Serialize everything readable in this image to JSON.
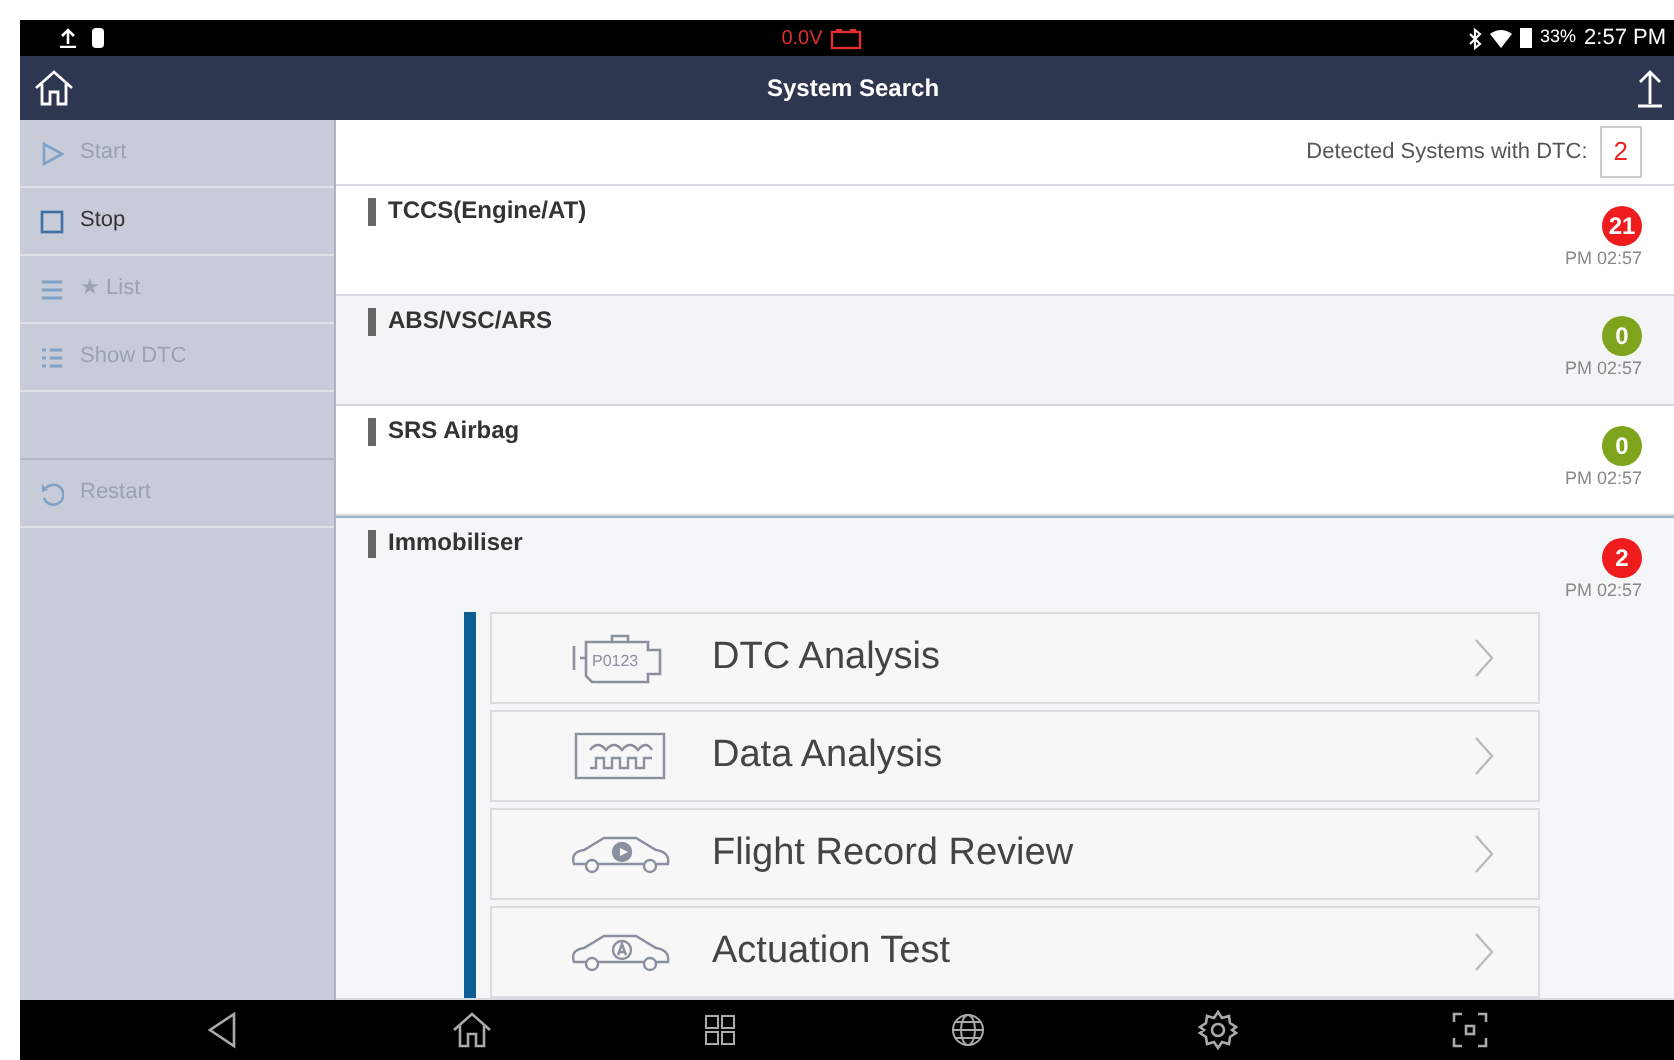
{
  "status_bar": {
    "voltage": "0.0V",
    "battery_percent": "33%",
    "time": "2:57 PM"
  },
  "title_bar": {
    "title": "System Search"
  },
  "sidebar": {
    "items": [
      {
        "kind": "play",
        "label": "Start",
        "disabled": true
      },
      {
        "kind": "stop",
        "label": "Stop",
        "disabled": false
      },
      {
        "kind": "list",
        "label": "★ List",
        "disabled": true
      },
      {
        "kind": "dtc",
        "label": "Show DTC",
        "disabled": true
      },
      {
        "kind": "blank"
      },
      {
        "kind": "restart",
        "label": "Restart",
        "disabled": true
      }
    ]
  },
  "summary": {
    "label": "Detected Systems with DTC:",
    "count": "2"
  },
  "systems": [
    {
      "name": "TCCS(Engine/AT)",
      "count": "21",
      "color": "#ee1c1c",
      "time": "PM 02:57",
      "expanded": false
    },
    {
      "name": "ABS/VSC/ARS",
      "count": "0",
      "color": "#7ea31c",
      "time": "PM 02:57",
      "expanded": false
    },
    {
      "name": "SRS Airbag",
      "count": "0",
      "color": "#7ea31c",
      "time": "PM 02:57",
      "expanded": false
    },
    {
      "name": "Immobiliser",
      "count": "2",
      "color": "#ee1c1c",
      "time": "PM 02:57",
      "expanded": true,
      "functions": [
        {
          "kind": "engine",
          "label": "DTC Analysis",
          "icon_label": "P0123"
        },
        {
          "kind": "wave",
          "label": "Data Analysis"
        },
        {
          "kind": "car-play",
          "label": "Flight Record Review"
        },
        {
          "kind": "car-a",
          "label": "Actuation Test"
        }
      ]
    }
  ]
}
